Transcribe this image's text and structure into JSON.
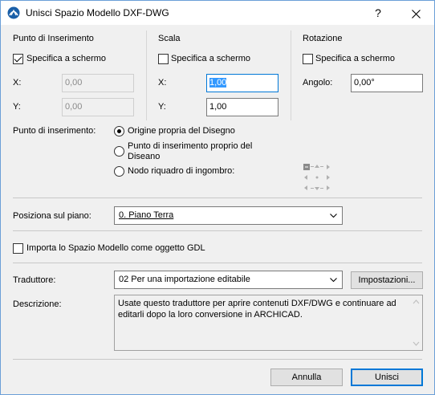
{
  "window": {
    "title": "Unisci Spazio Modello DXF-DWG",
    "help_label": "?",
    "close_label": "✕"
  },
  "insertion_point": {
    "heading": "Punto di Inserimento",
    "specify_label": "Specifica a schermo",
    "specify_checked": true,
    "x_label": "X:",
    "x_value": "0,00",
    "y_label": "Y:",
    "y_value": "0,00"
  },
  "scale": {
    "heading": "Scala",
    "specify_label": "Specifica a schermo",
    "specify_checked": false,
    "x_label": "X:",
    "x_value": "1,00",
    "y_label": "Y:",
    "y_value": "1,00"
  },
  "rotation": {
    "heading": "Rotazione",
    "specify_label": "Specifica a schermo",
    "specify_checked": false,
    "angle_label": "Angolo:",
    "angle_value": "0,00°"
  },
  "insertion_mode": {
    "label": "Punto di inserimento:",
    "options": [
      "Origine propria del Disegno",
      "Punto di inserimento proprio del Diseano",
      "Nodo riquadro di ingombro:"
    ],
    "selected_index": 0
  },
  "floor": {
    "label": "Posiziona sul piano:",
    "value": "0. Piano Terra"
  },
  "gdl": {
    "label": "Importa lo Spazio Modello come oggetto GDL",
    "checked": false
  },
  "translator": {
    "label": "Traduttore:",
    "value": "02 Per una importazione editabile",
    "settings_label": "Impostazioni..."
  },
  "description": {
    "label": "Descrizione:",
    "text": "Usate questo traduttore per aprire contenuti DXF/DWG e continuare ad editarli dopo la loro conversione in ARCHICAD."
  },
  "footer": {
    "cancel_label": "Annulla",
    "ok_label": "Unisci"
  },
  "colors": {
    "accent": "#0078d7",
    "selection": "#3399ff"
  }
}
